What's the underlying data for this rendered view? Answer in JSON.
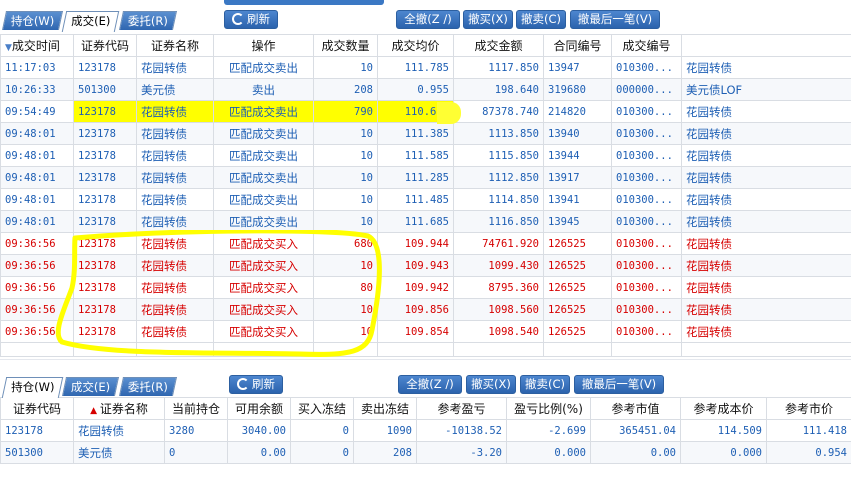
{
  "top": {
    "tabs": [
      "持仓(W)",
      "成交(E)",
      "委托(R)"
    ],
    "active_tab": 1,
    "refresh_label": "刷新",
    "actions": [
      "全撤(Z /)",
      "撤买(X)",
      "撤卖(C)",
      "撤最后一笔(V)"
    ]
  },
  "trades": {
    "columns": [
      "成交时间",
      "证券代码",
      "证券名称",
      "操作",
      "成交数量",
      "成交均价",
      "成交金额",
      "合同编号",
      "成交编号",
      ""
    ],
    "rows": [
      {
        "time": "11:17:03",
        "code": "123178",
        "name": "花园转债",
        "op": "匹配成交卖出",
        "qty": "10",
        "price": "111.785",
        "amount": "1117.850",
        "contract": "13947",
        "deal": "010300...",
        "extra": "花园转债",
        "color": "blue",
        "hl": false
      },
      {
        "time": "10:26:33",
        "code": "501300",
        "name": "美元债",
        "op": "卖出",
        "qty": "208",
        "price": "0.955",
        "amount": "198.640",
        "contract": "319680",
        "deal": "000000...",
        "extra": "美元债LOF",
        "color": "blue",
        "hl": false
      },
      {
        "time": "09:54:49",
        "code": "123178",
        "name": "花园转债",
        "op": "匹配成交卖出",
        "qty": "790",
        "price": "110.606",
        "amount": "87378.740",
        "contract": "214820",
        "deal": "010300...",
        "extra": "花园转债",
        "color": "blue",
        "hl": true
      },
      {
        "time": "09:48:01",
        "code": "123178",
        "name": "花园转债",
        "op": "匹配成交卖出",
        "qty": "10",
        "price": "111.385",
        "amount": "1113.850",
        "contract": "13940",
        "deal": "010300...",
        "extra": "花园转债",
        "color": "blue",
        "hl": false
      },
      {
        "time": "09:48:01",
        "code": "123178",
        "name": "花园转债",
        "op": "匹配成交卖出",
        "qty": "10",
        "price": "111.585",
        "amount": "1115.850",
        "contract": "13944",
        "deal": "010300...",
        "extra": "花园转债",
        "color": "blue",
        "hl": false
      },
      {
        "time": "09:48:01",
        "code": "123178",
        "name": "花园转债",
        "op": "匹配成交卖出",
        "qty": "10",
        "price": "111.285",
        "amount": "1112.850",
        "contract": "13917",
        "deal": "010300...",
        "extra": "花园转债",
        "color": "blue",
        "hl": false
      },
      {
        "time": "09:48:01",
        "code": "123178",
        "name": "花园转债",
        "op": "匹配成交卖出",
        "qty": "10",
        "price": "111.485",
        "amount": "1114.850",
        "contract": "13941",
        "deal": "010300...",
        "extra": "花园转债",
        "color": "blue",
        "hl": false
      },
      {
        "time": "09:48:01",
        "code": "123178",
        "name": "花园转债",
        "op": "匹配成交卖出",
        "qty": "10",
        "price": "111.685",
        "amount": "1116.850",
        "contract": "13945",
        "deal": "010300...",
        "extra": "花园转债",
        "color": "blue",
        "hl": false
      },
      {
        "time": "09:36:56",
        "code": "123178",
        "name": "花园转债",
        "op": "匹配成交买入",
        "qty": "680",
        "price": "109.944",
        "amount": "74761.920",
        "contract": "126525",
        "deal": "010300...",
        "extra": "花园转债",
        "color": "red",
        "hl": false
      },
      {
        "time": "09:36:56",
        "code": "123178",
        "name": "花园转债",
        "op": "匹配成交买入",
        "qty": "10",
        "price": "109.943",
        "amount": "1099.430",
        "contract": "126525",
        "deal": "010300...",
        "extra": "花园转债",
        "color": "red",
        "hl": false
      },
      {
        "time": "09:36:56",
        "code": "123178",
        "name": "花园转债",
        "op": "匹配成交买入",
        "qty": "80",
        "price": "109.942",
        "amount": "8795.360",
        "contract": "126525",
        "deal": "010300...",
        "extra": "花园转债",
        "color": "red",
        "hl": false
      },
      {
        "time": "09:36:56",
        "code": "123178",
        "name": "花园转债",
        "op": "匹配成交买入",
        "qty": "10",
        "price": "109.856",
        "amount": "1098.560",
        "contract": "126525",
        "deal": "010300...",
        "extra": "花园转债",
        "color": "red",
        "hl": false
      },
      {
        "time": "09:36:56",
        "code": "123178",
        "name": "花园转债",
        "op": "匹配成交买入",
        "qty": "10",
        "price": "109.854",
        "amount": "1098.540",
        "contract": "126525",
        "deal": "010300...",
        "extra": "花园转债",
        "color": "red",
        "hl": false
      }
    ]
  },
  "bottom": {
    "tabs": [
      "持仓(W)",
      "成交(E)",
      "委托(R)"
    ],
    "active_tab": 0,
    "refresh_label": "刷新",
    "actions": [
      "全撤(Z /)",
      "撤买(X)",
      "撤卖(C)",
      "撤最后一笔(V)"
    ]
  },
  "positions": {
    "columns": [
      "证券代码",
      "证券名称",
      "当前持仓",
      "可用余额",
      "买入冻结",
      "卖出冻结",
      "参考盈亏",
      "盈亏比例(%)",
      "参考市值",
      "参考成本价",
      "参考市价"
    ],
    "rows": [
      {
        "code": "123178",
        "name": "花园转债",
        "hold": "3280",
        "avail": "3040.00",
        "buyfrz": "0",
        "sellfrz": "1090",
        "pnl": "-10138.52",
        "ratio": "-2.699",
        "mv": "365451.04",
        "cost": "114.509",
        "mkt": "111.418"
      },
      {
        "code": "501300",
        "name": "美元债",
        "hold": "0",
        "avail": "0.00",
        "buyfrz": "0",
        "sellfrz": "208",
        "pnl": "-3.20",
        "ratio": "0.000",
        "mv": "0.00",
        "cost": "0.000",
        "mkt": "0.954"
      }
    ]
  },
  "colors": {
    "sell": "#1e5fb4",
    "buy": "#d60000",
    "highlight": "#ffff00",
    "button": "#2f66b0"
  }
}
